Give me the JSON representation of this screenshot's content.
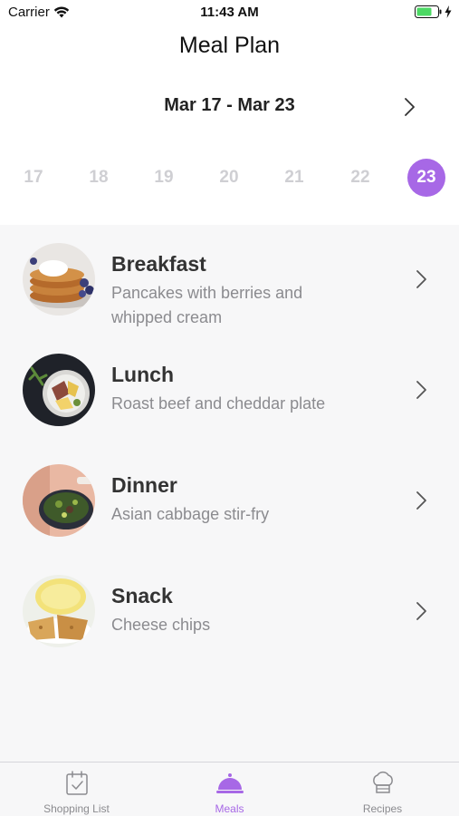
{
  "status": {
    "carrier": "Carrier",
    "time": "11:43 AM",
    "icons": [
      "wifi-icon",
      "battery-icon",
      "charging-icon"
    ]
  },
  "header": {
    "title": "Meal Plan"
  },
  "week": {
    "range": "Mar 17 - Mar 23",
    "days": [
      "17",
      "18",
      "19",
      "20",
      "21",
      "22",
      "23"
    ],
    "selected_day": "23"
  },
  "meals": [
    {
      "name": "Breakfast",
      "description": "Pancakes with berries and whipped cream"
    },
    {
      "name": "Lunch",
      "description": "Roast beef and cheddar plate"
    },
    {
      "name": "Dinner",
      "description": "Asian cabbage stir-fry"
    },
    {
      "name": "Snack",
      "description": "Cheese chips"
    }
  ],
  "tabbar": {
    "tabs": [
      {
        "label": "Shopping List",
        "icon": "calendar-check-icon"
      },
      {
        "label": "Meals",
        "icon": "cloche-icon"
      },
      {
        "label": "Recipes",
        "icon": "chef-hat-icon"
      }
    ],
    "active_tab": "Meals"
  },
  "colors": {
    "accent": "#a768e6",
    "inactive_day": "#cfcfd3",
    "secondary_text": "#8b8b8f"
  }
}
